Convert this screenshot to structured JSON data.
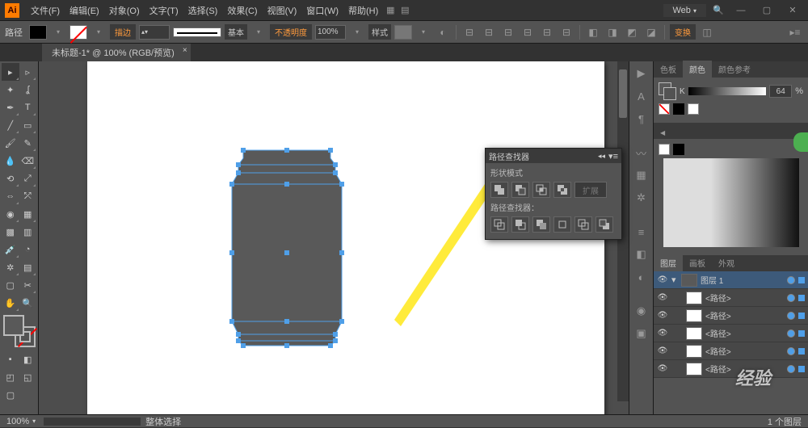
{
  "app": {
    "logo": "Ai"
  },
  "menu": {
    "file": "文件(F)",
    "edit": "编辑(E)",
    "object": "对象(O)",
    "type": "文字(T)",
    "select": "选择(S)",
    "effect": "效果(C)",
    "view": "视图(V)",
    "window": "窗口(W)",
    "help": "帮助(H)"
  },
  "workspace": "Web",
  "control": {
    "object_label": "路径",
    "stroke_btn": "描边",
    "basic": "基本",
    "opacity_lbl": "不透明度",
    "opacity_val": "100%",
    "style": "样式",
    "align_btn": "变换"
  },
  "doc": {
    "tab": "未标题-1* @ 100% (RGB/预览)"
  },
  "status": {
    "zoom": "100%",
    "info": "1 个图层",
    "sel": "整体选择"
  },
  "pathfinder": {
    "title": "路径查找器",
    "shape_modes": "形状模式",
    "expand": "扩展",
    "pathfinders": "路径查找器："
  },
  "panels": {
    "color": {
      "tab1": "色板",
      "tab2": "颜色",
      "tab3": "颜色参考",
      "value": "64",
      "pct": "%"
    },
    "gradient": {
      "icon": "渐"
    },
    "layers": {
      "tab1": "图层",
      "tab2": "画板",
      "tab3": "外观",
      "main": "图层 1",
      "item": "<路径>"
    }
  },
  "watermark": "经验",
  "chart_data": null
}
